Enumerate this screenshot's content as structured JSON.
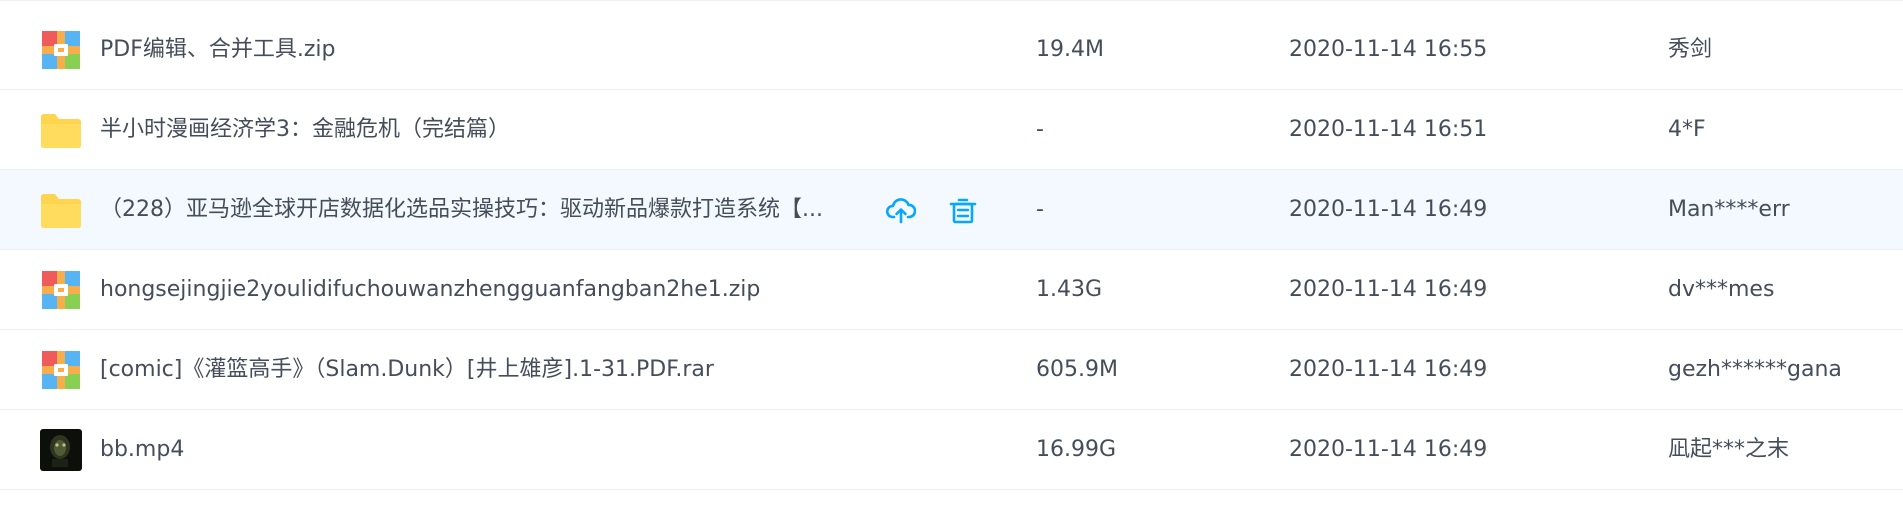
{
  "files": [
    {
      "name": "PDF编辑、合并工具.zip",
      "size": "19.4M",
      "time": "2020-11-14 16:55",
      "owner": "秀剑",
      "icon": "archive-icon"
    },
    {
      "name": "半小时漫画经济学3：金融危机（完结篇）",
      "size": "-",
      "time": "2020-11-14 16:51",
      "owner": "4*F",
      "icon": "folder-icon"
    },
    {
      "name": "（228）亚马逊全球开店数据化选品实操技巧：驱动新品爆款打造系统【...",
      "size": "-",
      "time": "2020-11-14 16:49",
      "owner": "Man****err",
      "icon": "folder-icon"
    },
    {
      "name": "hongsejingjie2youlidifuchouwanzhengguanfangban2he1.zip",
      "size": "1.43G",
      "time": "2020-11-14 16:49",
      "owner": "dv***mes",
      "icon": "archive-icon"
    },
    {
      "name": "[comic]《灌篮高手》（Slam.Dunk）[井上雄彦].1-31.PDF.rar",
      "size": "605.9M",
      "time": "2020-11-14 16:49",
      "owner": "gezh******gana",
      "icon": "archive-icon"
    },
    {
      "name": "bb.mp4",
      "size": "16.99G",
      "time": "2020-11-14 16:49",
      "owner": "凪起***之末",
      "icon": "video-thumbnail-icon"
    }
  ],
  "row_actions": {
    "upload_icon": "cloud-upload-icon",
    "delete_icon": "trash-icon"
  },
  "colors": {
    "text": "#454d5a",
    "accent": "#06a7ff",
    "hover_row": "#f3f9fe",
    "folder": "#ffd54f"
  }
}
